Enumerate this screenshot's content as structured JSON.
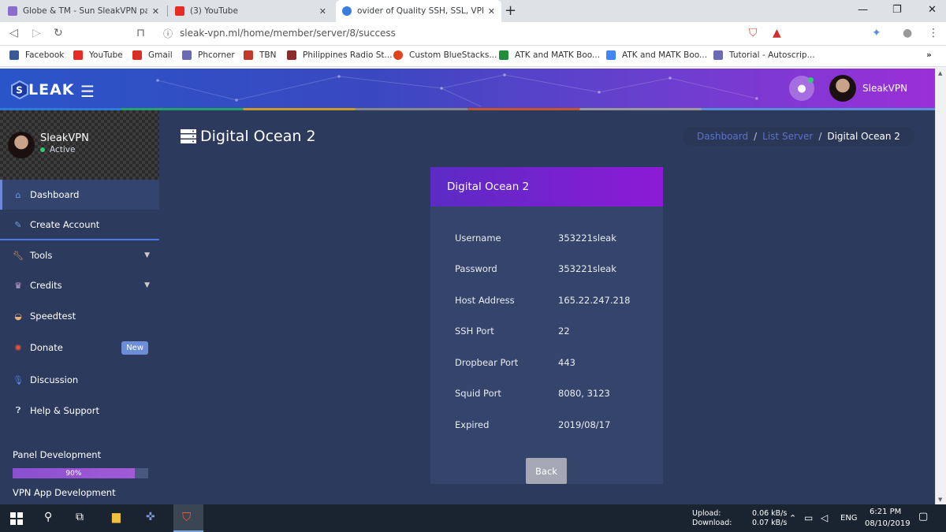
{
  "browser": {
    "tabs": [
      {
        "label": "Globe & TM - Sun SleakVPN panel",
        "color": "#8a6ccf"
      },
      {
        "label": "(3) YouTube",
        "color": "#e52d27"
      },
      {
        "label": "ovider of Quality SSH, SSL, VPN ac",
        "color": "#3b7ddd"
      }
    ],
    "url": "sleak-vpn.ml/home/member/server/8/success",
    "bookmarks": [
      {
        "label": "Facebook",
        "color": "#3b5998"
      },
      {
        "label": "YouTube",
        "color": "#e52d27"
      },
      {
        "label": "Gmail",
        "color": "#d93025"
      },
      {
        "label": "Phcorner",
        "color": "#6b6bb5"
      },
      {
        "label": "TBN",
        "color": "#c0392b"
      },
      {
        "label": "Philippines Radio St...",
        "color": "#8b2c2c"
      },
      {
        "label": "Custom BlueStacks...",
        "color": "#e0421e"
      },
      {
        "label": "ATK and MATK Boo...",
        "color": "#1e8e3e"
      },
      {
        "label": "ATK and MATK Boo...",
        "color": "#4285f4"
      },
      {
        "label": "Tutorial - Autoscrip...",
        "color": "#6b6bb5"
      }
    ],
    "more_bookmarks": "»"
  },
  "header": {
    "logo_text": "LEAK",
    "user_name": "SleakVPN"
  },
  "sidebar": {
    "profile_name": "SleakVPN",
    "profile_status": "Active",
    "items": [
      {
        "label": "Dashboard",
        "icon": "home-icon"
      },
      {
        "label": "Create Account",
        "icon": "pencil-icon"
      },
      {
        "label": "Tools",
        "icon": "wrench-icon"
      },
      {
        "label": "Credits",
        "icon": "crown-icon"
      },
      {
        "label": "Speedtest",
        "icon": "gauge-icon"
      },
      {
        "label": "Donate",
        "icon": "donate-icon",
        "badge": "New"
      },
      {
        "label": "Discussion",
        "icon": "mic-icon"
      },
      {
        "label": "Help & Support",
        "icon": "question-icon"
      }
    ],
    "progress": [
      {
        "title": "Panel Development",
        "label": "90%",
        "value": 0.9
      },
      {
        "title": "VPN App Development"
      }
    ]
  },
  "page": {
    "title": "Digital Ocean 2",
    "breadcrumb": [
      "Dashboard",
      "List Server",
      "Digital Ocean 2"
    ],
    "breadcrumb_sep": "/"
  },
  "card": {
    "title": "Digital Ocean 2",
    "rows": [
      {
        "key": "Username",
        "value": "353221sleak"
      },
      {
        "key": "Password",
        "value": "353221sleak"
      },
      {
        "key": "Host Address",
        "value": "165.22.247.218"
      },
      {
        "key": "SSH Port",
        "value": "22"
      },
      {
        "key": "Dropbear Port",
        "value": "443"
      },
      {
        "key": "Squid Port",
        "value": "8080, 3123"
      },
      {
        "key": "Expired",
        "value": "2019/08/17"
      }
    ],
    "back_label": "Back"
  },
  "taskbar": {
    "upload_label": "Upload:",
    "upload_value": "0.06 kB/s",
    "download_label": "Download:",
    "download_value": "0.07 kB/s",
    "lang": "ENG",
    "time": "6:21 PM",
    "date": "08/10/2019"
  },
  "colors": {
    "sidebar_bg": "#2c3a5e",
    "card_header": "#8d1ad6",
    "accent": "#6c8dd8",
    "online": "#2ecc71"
  }
}
